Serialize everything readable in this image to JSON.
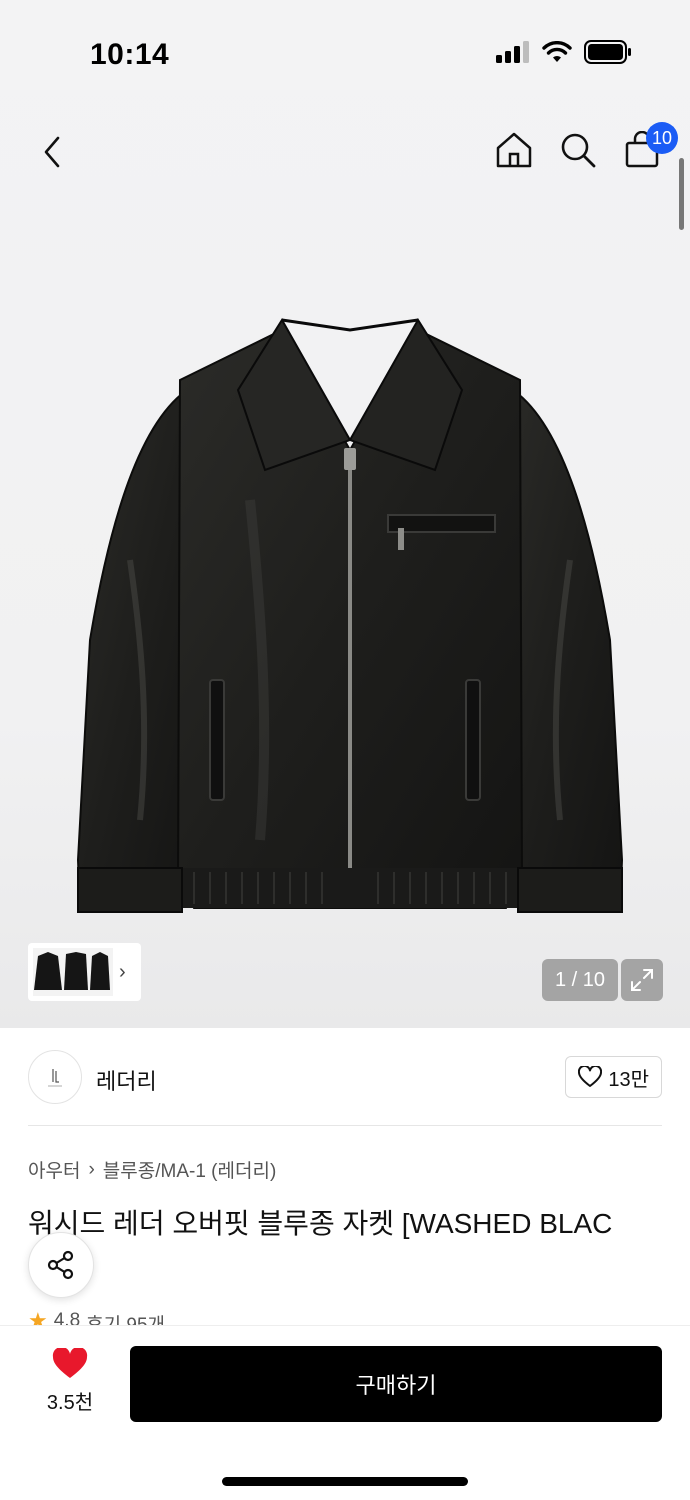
{
  "status_bar": {
    "time": "10:14"
  },
  "nav": {
    "back_icon": "chevron-left-icon",
    "home_icon": "home-icon",
    "search_icon": "search-icon",
    "cart_icon": "shopping-bag-icon",
    "cart_count": "10",
    "badge_color": "#1b5cf5"
  },
  "gallery": {
    "page_counter": "1 / 10",
    "expand_icon": "expand-icon",
    "thumbnail_chevron": "›"
  },
  "brand": {
    "name": "레더리",
    "like_count": "13만"
  },
  "product": {
    "breadcrumb": [
      "아우터",
      "블루종/MA-1 (레더리)"
    ],
    "title": "워시드 레더 오버핏 블루종 자켓 [WASHED BLAC",
    "rating": "4.8",
    "reviews": "후기 95개"
  },
  "bottom_bar": {
    "wish_count": "3.5천",
    "buy_label": "구매하기",
    "wish_color": "#e8182c"
  }
}
